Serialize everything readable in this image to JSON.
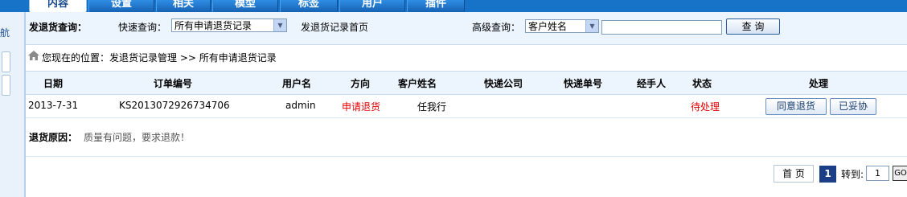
{
  "top_tabs": [
    "内容",
    "设置",
    "相关",
    "模型",
    "标签",
    "用户",
    "插件"
  ],
  "active_tab": "内容",
  "left_nav": {
    "label": "航"
  },
  "query_bar": {
    "title": "发退货查询：",
    "quick_label": "快速查询：",
    "quick_select_value": "所有申请退货记录",
    "home_link": "发退货记录首页",
    "advanced_label": "高级查询：",
    "advanced_select_value": "客户姓名",
    "search_input_value": "",
    "query_button": "查 询"
  },
  "breadcrumb": {
    "text": "您现在的位置：发退货记录管理 >> 所有申请退货记录"
  },
  "table": {
    "headers": [
      "日期",
      "订单编号",
      "用户名",
      "方向",
      "客户姓名",
      "快递公司",
      "快递单号",
      "经手人",
      "状态",
      "处理"
    ],
    "rows": [
      {
        "date": "2013-7-31",
        "order_no": "KS2013072926734706",
        "username": "admin",
        "direction": "申请退货",
        "customer": "任我行",
        "courier": "",
        "tracking_no": "",
        "handler": "",
        "status": "待处理",
        "actions": [
          "同意退货",
          "已妥协"
        ]
      }
    ]
  },
  "reason": {
    "label": "退货原因：",
    "text": "质量有问题，要求退款！"
  },
  "pagination": {
    "first_page": "首 页",
    "current_page": "1",
    "goto_label": "转到:",
    "goto_value": "1",
    "go_button": "GO"
  },
  "colors": {
    "topbar": "#1773c8",
    "header_bg": "#ecf4fd",
    "status_red": "#e00000",
    "page_current": "#1a3f87"
  }
}
